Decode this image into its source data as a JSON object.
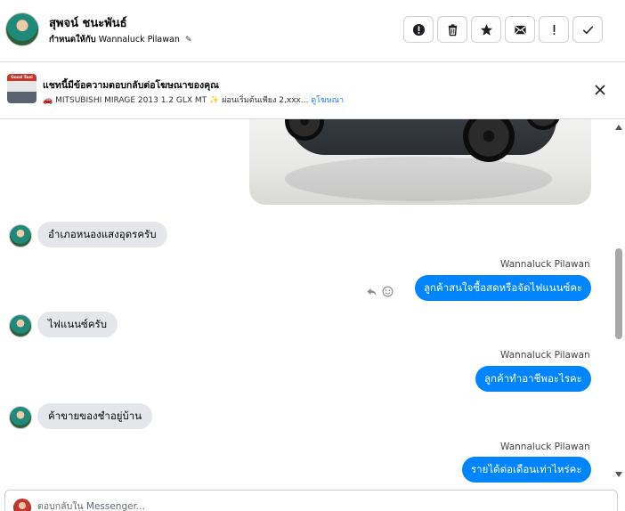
{
  "header": {
    "contact_name": "สุพจน์ ชนะพันธ์",
    "assign_label": "กำหนดให้กับ",
    "assignee": "Wannaluck Pilawan",
    "actions": [
      {
        "icon": "alert-circle-icon"
      },
      {
        "icon": "trash-icon"
      },
      {
        "icon": "star-icon"
      },
      {
        "icon": "mail-icon"
      },
      {
        "icon": "exclamation-icon"
      },
      {
        "icon": "check-icon"
      }
    ]
  },
  "ad": {
    "thumb_label": "Good Taxi",
    "title": "แชทนี้มีข้อความตอบกลับต่อโฆษณาของคุณ",
    "description": "🚗 MITSUBISHI MIRAGE 2013 1.2 GLX MT ✨ ผ่อนเริ่มต้นเพียง 2,xxx...",
    "see_ad": "ดูโฆษณา"
  },
  "messages": [
    {
      "direction": "in",
      "text": "อำเภอหนองแสงอุดรครับ"
    },
    {
      "direction": "out",
      "sender": "Wannaluck Pilawan",
      "text": "ลูกค้าสนใจซื้อสดหรือจัดไฟแนนซ์คะ"
    },
    {
      "direction": "in",
      "text": "ไฟแนนซ์ครับ"
    },
    {
      "direction": "out",
      "sender": "Wannaluck Pilawan",
      "text": "ลูกค้าทำอาชีพอะไรคะ"
    },
    {
      "direction": "in",
      "text": "ค้าขายของชำอยู่บ้าน"
    },
    {
      "direction": "out",
      "sender": "Wannaluck Pilawan",
      "text": "รายได้ต่อเดือนเท่าไหร่คะ"
    }
  ],
  "reply": {
    "placeholder": "ตอบกลับใน Messenger..."
  },
  "colors": {
    "outgoing_bubble": "#0084ff",
    "incoming_bubble": "#e4e6eb",
    "link": "#1877f2"
  }
}
